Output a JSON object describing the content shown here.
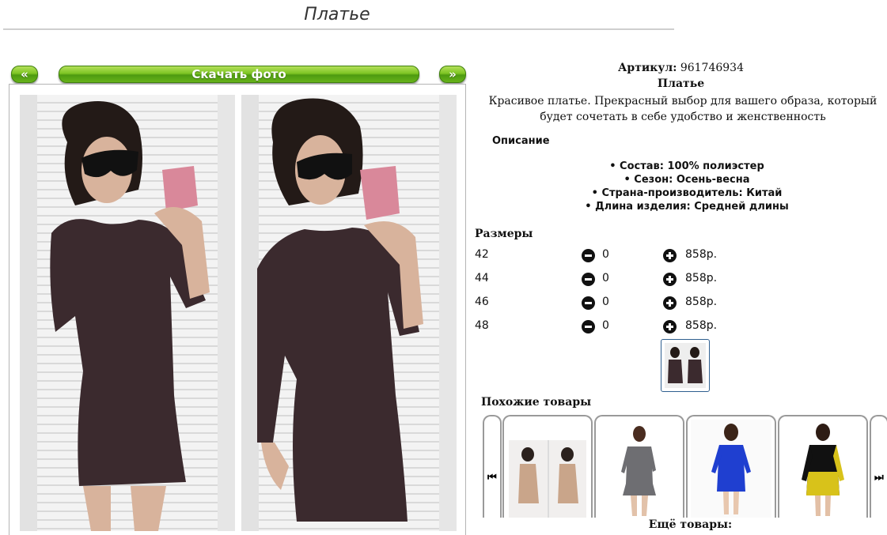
{
  "header": {
    "title": "Платье"
  },
  "gallery": {
    "prev_label": "«",
    "download_label": "Скачать фото",
    "next_label": "»"
  },
  "product": {
    "article_label": "Артикул:",
    "article_value": "961746934",
    "name": "Платье",
    "description": "Красивое платье. Прекрасный выбор для вашего образа, который будет сочетать в себе удобство и женственность",
    "description_heading": "Описание",
    "specs": [
      "Состав: 100% полиэстер",
      "Сезон: Осень-весна",
      "Страна-производитель: Китай",
      "Длина изделия: Средней длины"
    ]
  },
  "sizes": {
    "heading": "Размеры",
    "rows": [
      {
        "size": "42",
        "qty": "0",
        "price": "858р."
      },
      {
        "size": "44",
        "qty": "0",
        "price": "858р."
      },
      {
        "size": "46",
        "qty": "0",
        "price": "858р."
      },
      {
        "size": "48",
        "qty": "0",
        "price": "858р."
      }
    ]
  },
  "similar": {
    "heading": "Похожие товары",
    "prev_icon": "skip-back-icon",
    "next_icon": "skip-forward-icon",
    "prev_glyph": "⏮",
    "next_glyph": "⏭",
    "items": [
      {
        "image": "beige-dress-photo",
        "dress_color": "#c9a58a"
      },
      {
        "image": "gray-dress-photo",
        "dress_color": "#6e6e72"
      },
      {
        "image": "blue-dress-photo",
        "dress_color": "#1f3fd0"
      },
      {
        "image": "black-yellow-dress-photo",
        "dress_color": "#d8c21a"
      }
    ]
  },
  "footer": {
    "more_label": "Ещё товары:"
  },
  "colors": {
    "button_green": "#7dc423",
    "dress_main": "#3b2a2e",
    "thumb_border": "#2f5f8f"
  }
}
